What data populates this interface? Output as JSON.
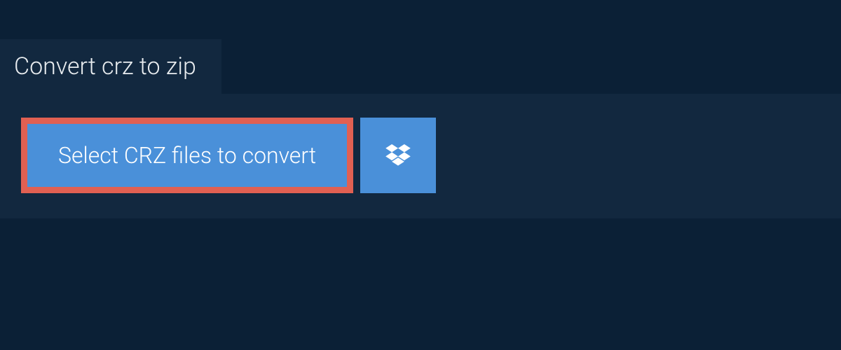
{
  "tab": {
    "title": "Convert crz to zip"
  },
  "actions": {
    "select_files_label": "Select CRZ files to convert"
  }
}
